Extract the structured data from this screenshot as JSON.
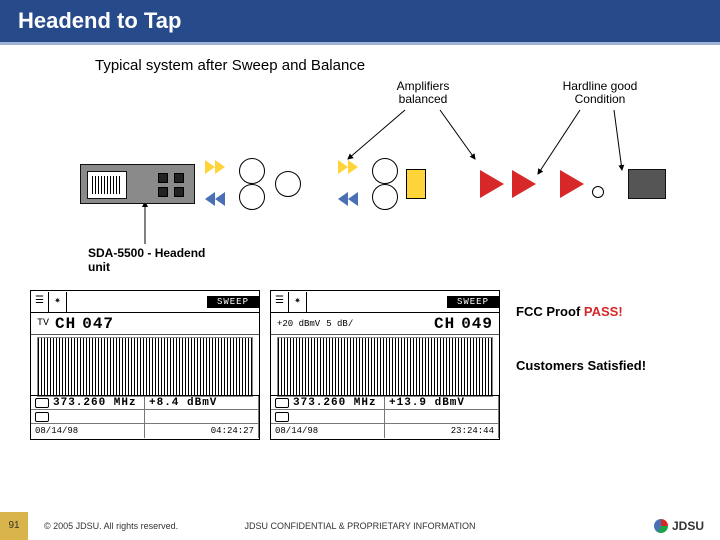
{
  "header": {
    "title": "Headend to Tap"
  },
  "subtitle": "Typical system after Sweep and Balance",
  "callouts": {
    "amplifiers": "Amplifiers balanced",
    "hardline": "Hardline good Condition",
    "sda": "SDA-5500 - Headend unit"
  },
  "sweeps": [
    {
      "title": "SWEEP",
      "unit": "TV",
      "ch_label": "CH",
      "ch_num": "047",
      "freq": "373.260 MHz",
      "level": "+8.4 dBmV",
      "date": "08/14/98",
      "time": "04:24:27"
    },
    {
      "title": "SWEEP",
      "ref": "+20 dBmV",
      "scale": "5 dB/",
      "ch_label": "CH",
      "ch_num": "049",
      "freq": "373.260 MHz",
      "level": "+13.9 dBmV",
      "date": "08/14/98",
      "time": "23:24:44"
    }
  ],
  "side": {
    "fcc": "FCC Proof ",
    "pass": "PASS!",
    "customers": "Customers Satisfied!"
  },
  "footer": {
    "page": "91",
    "copyright": "© 2005 JDSU. All rights reserved.",
    "confidential": "JDSU CONFIDENTIAL & PROPRIETARY INFORMATION",
    "logo": "JDSU"
  }
}
